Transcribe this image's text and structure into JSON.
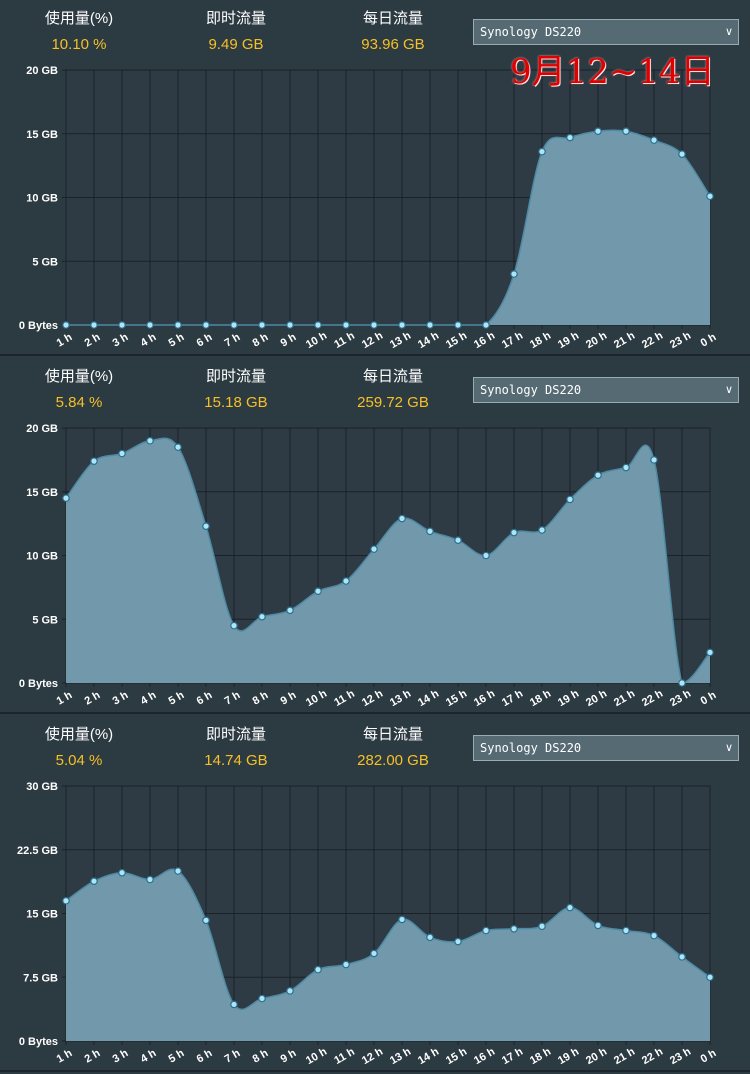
{
  "overlay": {
    "date_text": "9月12~14日"
  },
  "colors": {
    "background": "#2c3a42",
    "area_fill": "#7199ab",
    "line": "#8fc7dd",
    "point": "#aee4f7",
    "stat_value": "#f6c026",
    "grid": "#1a2228"
  },
  "panels": [
    {
      "stats": {
        "usage_label": "使用量(%)",
        "usage_value": "10.10 %",
        "current_label": "即时流量",
        "current_value": "9.49 GB",
        "daily_label": "每日流量",
        "daily_value": "93.96 GB"
      },
      "device": "Synology DS220",
      "chart_data": {
        "type": "area",
        "categories": [
          "1 h",
          "2 h",
          "3 h",
          "4 h",
          "5 h",
          "6 h",
          "7 h",
          "8 h",
          "9 h",
          "10 h",
          "11 h",
          "12 h",
          "13 h",
          "14 h",
          "15 h",
          "16 h",
          "17 h",
          "18 h",
          "19 h",
          "20 h",
          "21 h",
          "22 h",
          "23 h",
          "0 h"
        ],
        "yticks": [
          "0 Bytes",
          "5 GB",
          "10 GB",
          "15 GB",
          "20 GB"
        ],
        "ylim": [
          0,
          20
        ],
        "series": [
          {
            "values": [
              0,
              0,
              0,
              0,
              0,
              0,
              0,
              0,
              0,
              0,
              0,
              0,
              0,
              0,
              0,
              0,
              4.0,
              13.6,
              14.7,
              15.2,
              15.2,
              14.5,
              13.4,
              10.1
            ]
          }
        ]
      }
    },
    {
      "stats": {
        "usage_label": "使用量(%)",
        "usage_value": "5.84 %",
        "current_label": "即时流量",
        "current_value": "15.18 GB",
        "daily_label": "每日流量",
        "daily_value": "259.72 GB"
      },
      "device": "Synology DS220",
      "chart_data": {
        "type": "area",
        "categories": [
          "1 h",
          "2 h",
          "3 h",
          "4 h",
          "5 h",
          "6 h",
          "7 h",
          "8 h",
          "9 h",
          "10 h",
          "11 h",
          "12 h",
          "13 h",
          "14 h",
          "15 h",
          "16 h",
          "17 h",
          "18 h",
          "19 h",
          "20 h",
          "21 h",
          "22 h",
          "23 h",
          "0 h"
        ],
        "yticks": [
          "0 Bytes",
          "5 GB",
          "10 GB",
          "15 GB",
          "20 GB"
        ],
        "ylim": [
          0,
          20
        ],
        "series": [
          {
            "values": [
              14.5,
              17.4,
              18.0,
              19.0,
              18.5,
              12.3,
              4.5,
              5.2,
              5.7,
              7.2,
              8.0,
              10.5,
              12.9,
              11.9,
              11.2,
              10.0,
              11.8,
              12.0,
              14.4,
              16.3,
              16.9,
              17.5,
              0.0,
              2.4
            ]
          }
        ]
      }
    },
    {
      "stats": {
        "usage_label": "使用量(%)",
        "usage_value": "5.04 %",
        "current_label": "即时流量",
        "current_value": "14.74 GB",
        "daily_label": "每日流量",
        "daily_value": "282.00 GB"
      },
      "device": "Synology DS220",
      "chart_data": {
        "type": "area",
        "categories": [
          "1 h",
          "2 h",
          "3 h",
          "4 h",
          "5 h",
          "6 h",
          "7 h",
          "8 h",
          "9 h",
          "10 h",
          "11 h",
          "12 h",
          "13 h",
          "14 h",
          "15 h",
          "16 h",
          "17 h",
          "18 h",
          "19 h",
          "20 h",
          "21 h",
          "22 h",
          "23 h",
          "0 h"
        ],
        "yticks": [
          "0 Bytes",
          "7.5 GB",
          "15 GB",
          "22.5 GB",
          "30 GB"
        ],
        "ylim": [
          0,
          30
        ],
        "series": [
          {
            "values": [
              16.5,
              18.8,
              19.8,
              19.0,
              20.0,
              14.2,
              4.3,
              5.0,
              5.9,
              8.4,
              9.0,
              10.3,
              14.3,
              12.2,
              11.7,
              13.0,
              13.2,
              13.5,
              15.7,
              13.6,
              13.0,
              12.4,
              9.9,
              7.5
            ]
          }
        ]
      }
    }
  ]
}
